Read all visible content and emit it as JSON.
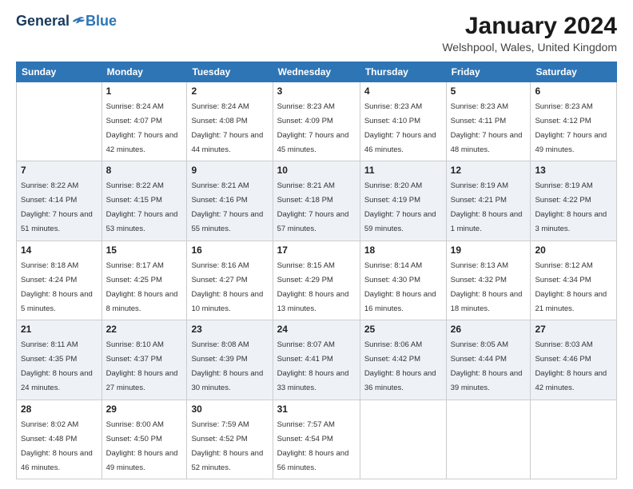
{
  "logo": {
    "general": "General",
    "blue": "Blue"
  },
  "title": "January 2024",
  "location": "Welshpool, Wales, United Kingdom",
  "days_of_week": [
    "Sunday",
    "Monday",
    "Tuesday",
    "Wednesday",
    "Thursday",
    "Friday",
    "Saturday"
  ],
  "weeks": [
    [
      {
        "day": "",
        "sunrise": "",
        "sunset": "",
        "daylight": ""
      },
      {
        "day": "1",
        "sunrise": "Sunrise: 8:24 AM",
        "sunset": "Sunset: 4:07 PM",
        "daylight": "Daylight: 7 hours and 42 minutes."
      },
      {
        "day": "2",
        "sunrise": "Sunrise: 8:24 AM",
        "sunset": "Sunset: 4:08 PM",
        "daylight": "Daylight: 7 hours and 44 minutes."
      },
      {
        "day": "3",
        "sunrise": "Sunrise: 8:23 AM",
        "sunset": "Sunset: 4:09 PM",
        "daylight": "Daylight: 7 hours and 45 minutes."
      },
      {
        "day": "4",
        "sunrise": "Sunrise: 8:23 AM",
        "sunset": "Sunset: 4:10 PM",
        "daylight": "Daylight: 7 hours and 46 minutes."
      },
      {
        "day": "5",
        "sunrise": "Sunrise: 8:23 AM",
        "sunset": "Sunset: 4:11 PM",
        "daylight": "Daylight: 7 hours and 48 minutes."
      },
      {
        "day": "6",
        "sunrise": "Sunrise: 8:23 AM",
        "sunset": "Sunset: 4:12 PM",
        "daylight": "Daylight: 7 hours and 49 minutes."
      }
    ],
    [
      {
        "day": "7",
        "sunrise": "Sunrise: 8:22 AM",
        "sunset": "Sunset: 4:14 PM",
        "daylight": "Daylight: 7 hours and 51 minutes."
      },
      {
        "day": "8",
        "sunrise": "Sunrise: 8:22 AM",
        "sunset": "Sunset: 4:15 PM",
        "daylight": "Daylight: 7 hours and 53 minutes."
      },
      {
        "day": "9",
        "sunrise": "Sunrise: 8:21 AM",
        "sunset": "Sunset: 4:16 PM",
        "daylight": "Daylight: 7 hours and 55 minutes."
      },
      {
        "day": "10",
        "sunrise": "Sunrise: 8:21 AM",
        "sunset": "Sunset: 4:18 PM",
        "daylight": "Daylight: 7 hours and 57 minutes."
      },
      {
        "day": "11",
        "sunrise": "Sunrise: 8:20 AM",
        "sunset": "Sunset: 4:19 PM",
        "daylight": "Daylight: 7 hours and 59 minutes."
      },
      {
        "day": "12",
        "sunrise": "Sunrise: 8:19 AM",
        "sunset": "Sunset: 4:21 PM",
        "daylight": "Daylight: 8 hours and 1 minute."
      },
      {
        "day": "13",
        "sunrise": "Sunrise: 8:19 AM",
        "sunset": "Sunset: 4:22 PM",
        "daylight": "Daylight: 8 hours and 3 minutes."
      }
    ],
    [
      {
        "day": "14",
        "sunrise": "Sunrise: 8:18 AM",
        "sunset": "Sunset: 4:24 PM",
        "daylight": "Daylight: 8 hours and 5 minutes."
      },
      {
        "day": "15",
        "sunrise": "Sunrise: 8:17 AM",
        "sunset": "Sunset: 4:25 PM",
        "daylight": "Daylight: 8 hours and 8 minutes."
      },
      {
        "day": "16",
        "sunrise": "Sunrise: 8:16 AM",
        "sunset": "Sunset: 4:27 PM",
        "daylight": "Daylight: 8 hours and 10 minutes."
      },
      {
        "day": "17",
        "sunrise": "Sunrise: 8:15 AM",
        "sunset": "Sunset: 4:29 PM",
        "daylight": "Daylight: 8 hours and 13 minutes."
      },
      {
        "day": "18",
        "sunrise": "Sunrise: 8:14 AM",
        "sunset": "Sunset: 4:30 PM",
        "daylight": "Daylight: 8 hours and 16 minutes."
      },
      {
        "day": "19",
        "sunrise": "Sunrise: 8:13 AM",
        "sunset": "Sunset: 4:32 PM",
        "daylight": "Daylight: 8 hours and 18 minutes."
      },
      {
        "day": "20",
        "sunrise": "Sunrise: 8:12 AM",
        "sunset": "Sunset: 4:34 PM",
        "daylight": "Daylight: 8 hours and 21 minutes."
      }
    ],
    [
      {
        "day": "21",
        "sunrise": "Sunrise: 8:11 AM",
        "sunset": "Sunset: 4:35 PM",
        "daylight": "Daylight: 8 hours and 24 minutes."
      },
      {
        "day": "22",
        "sunrise": "Sunrise: 8:10 AM",
        "sunset": "Sunset: 4:37 PM",
        "daylight": "Daylight: 8 hours and 27 minutes."
      },
      {
        "day": "23",
        "sunrise": "Sunrise: 8:08 AM",
        "sunset": "Sunset: 4:39 PM",
        "daylight": "Daylight: 8 hours and 30 minutes."
      },
      {
        "day": "24",
        "sunrise": "Sunrise: 8:07 AM",
        "sunset": "Sunset: 4:41 PM",
        "daylight": "Daylight: 8 hours and 33 minutes."
      },
      {
        "day": "25",
        "sunrise": "Sunrise: 8:06 AM",
        "sunset": "Sunset: 4:42 PM",
        "daylight": "Daylight: 8 hours and 36 minutes."
      },
      {
        "day": "26",
        "sunrise": "Sunrise: 8:05 AM",
        "sunset": "Sunset: 4:44 PM",
        "daylight": "Daylight: 8 hours and 39 minutes."
      },
      {
        "day": "27",
        "sunrise": "Sunrise: 8:03 AM",
        "sunset": "Sunset: 4:46 PM",
        "daylight": "Daylight: 8 hours and 42 minutes."
      }
    ],
    [
      {
        "day": "28",
        "sunrise": "Sunrise: 8:02 AM",
        "sunset": "Sunset: 4:48 PM",
        "daylight": "Daylight: 8 hours and 46 minutes."
      },
      {
        "day": "29",
        "sunrise": "Sunrise: 8:00 AM",
        "sunset": "Sunset: 4:50 PM",
        "daylight": "Daylight: 8 hours and 49 minutes."
      },
      {
        "day": "30",
        "sunrise": "Sunrise: 7:59 AM",
        "sunset": "Sunset: 4:52 PM",
        "daylight": "Daylight: 8 hours and 52 minutes."
      },
      {
        "day": "31",
        "sunrise": "Sunrise: 7:57 AM",
        "sunset": "Sunset: 4:54 PM",
        "daylight": "Daylight: 8 hours and 56 minutes."
      },
      {
        "day": "",
        "sunrise": "",
        "sunset": "",
        "daylight": ""
      },
      {
        "day": "",
        "sunrise": "",
        "sunset": "",
        "daylight": ""
      },
      {
        "day": "",
        "sunrise": "",
        "sunset": "",
        "daylight": ""
      }
    ]
  ]
}
